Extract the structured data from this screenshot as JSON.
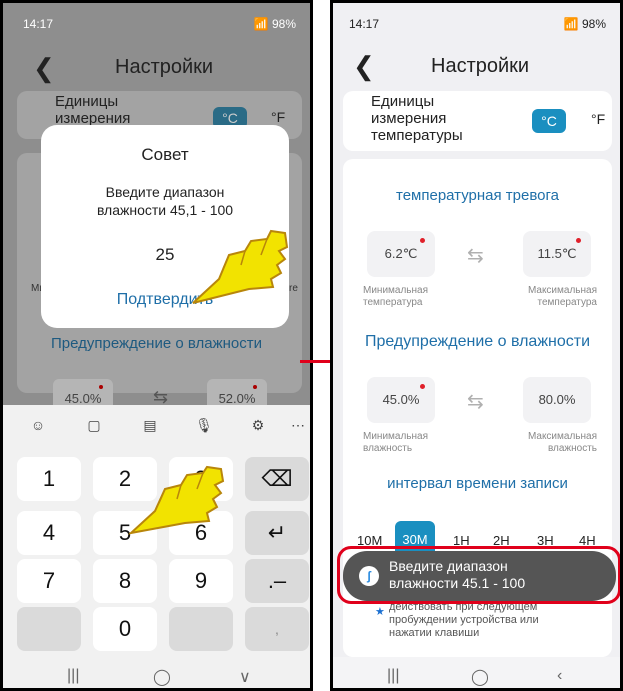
{
  "left": {
    "status": {
      "time": "14:17",
      "battery": "98%"
    },
    "header": {
      "back": "❮",
      "title": "Настройки"
    },
    "units": {
      "label": "Единицы измерения",
      "celsius": "°C",
      "fahrenheit": "°F"
    },
    "edge_left": "Ми",
    "edge_right": "re",
    "humidity_title": "Предупреждение о влажности",
    "min_value": "45.0%",
    "max_value": "52.0%",
    "dialog": {
      "title": "Совет",
      "message": "Введите диапазон влажности 45,1 - 100",
      "value": "25",
      "confirm": "Подтвердить"
    },
    "keyboard": {
      "keys": [
        "1",
        "2",
        "3",
        "4",
        "5",
        "6",
        "7",
        "8",
        "9",
        "0"
      ],
      "dot_dash": ".–",
      "comma": ","
    },
    "nav": {
      "recent": "|||",
      "home": "◯",
      "back": "∨"
    }
  },
  "right": {
    "status": {
      "time": "14:17",
      "battery": "98%"
    },
    "header": {
      "back": "❮",
      "title": "Настройки"
    },
    "units": {
      "label": "Единицы измерения температуры",
      "celsius": "°C",
      "fahrenheit": "°F"
    },
    "temp_alarm": {
      "title": "температурная тревога",
      "min": "6.2℃",
      "max": "11.5℃",
      "min_label": "Минимальная температура",
      "max_label": "Максимальная температура"
    },
    "humidity": {
      "title": "Предупреждение о влажности",
      "min": "45.0%",
      "max": "80.0%",
      "min_label": "Минимальная влажность",
      "max_label": "Максимальная влажность"
    },
    "interval": {
      "title": "интервал времени записи",
      "tabs": [
        "10M",
        "30M",
        "1H",
        "2H",
        "3H",
        "4H"
      ],
      "active": "30M"
    },
    "note": "действовать при следующем пробуждении устройства или нажатии клавиши",
    "toast": "Введите диапазон влажности 45.1 - 100",
    "nav": {
      "recent": "|||",
      "home": "◯",
      "back": "‹"
    }
  },
  "colors": {
    "accent": "#1a8fc0",
    "link": "#1f6fa8",
    "alert": "#e0202a",
    "annotation": "#e0001b"
  }
}
